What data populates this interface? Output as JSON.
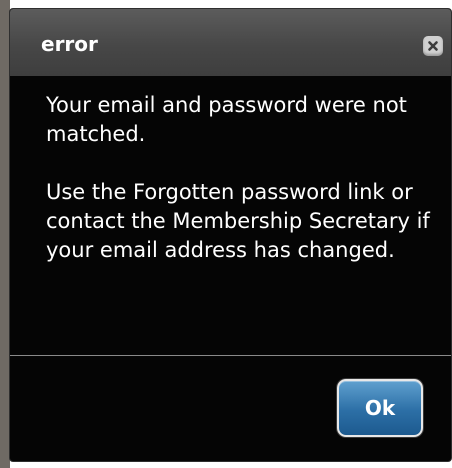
{
  "dialog": {
    "title": "error",
    "close_icon": "close-icon",
    "message_line_1": "Your email and password were not matched.",
    "message_line_2": "Use the Forgotten password link or contact the Membership Secretary if your email address has changed.",
    "ok_label": "Ok"
  },
  "colors": {
    "dialog_background": "#050505",
    "titlebar": "#4a4a4a",
    "button_accent": "#2c6fa6"
  }
}
